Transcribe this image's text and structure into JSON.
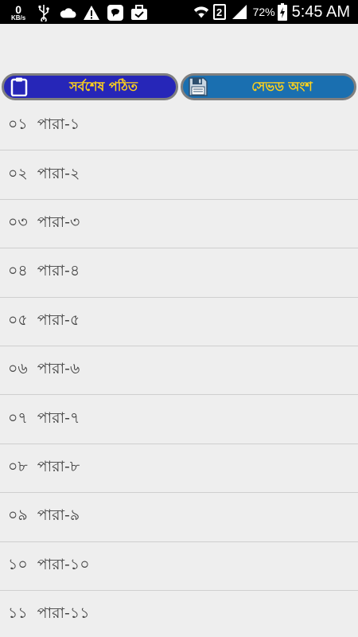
{
  "status_bar": {
    "net_speed_value": "0",
    "net_speed_unit": "KB/s",
    "sim_slot": "2",
    "battery_percent": "72%",
    "time": "5:45 AM",
    "icons": [
      "usb-icon",
      "cloud-icon",
      "warning-icon",
      "chat-icon",
      "briefcase-icon",
      "wifi-icon",
      "signal-icon",
      "battery-charging-icon"
    ]
  },
  "toolbar": {
    "recent_label": "সর্বশেষ পঠিত",
    "recent_icon": "clipboard-icon",
    "saved_label": "সেভড অংশ",
    "saved_icon": "save-icon"
  },
  "colors": {
    "recent_button_bg": "#2626b8",
    "saved_button_bg": "#1a6fb0",
    "label_color": "#ffd21a",
    "background": "#eeeeee"
  },
  "items": [
    {
      "num": "০১",
      "name": "পারা-১"
    },
    {
      "num": "০২",
      "name": "পারা-২"
    },
    {
      "num": "০৩",
      "name": "পারা-৩"
    },
    {
      "num": "০৪",
      "name": "পারা-৪"
    },
    {
      "num": "০৫",
      "name": "পারা-৫"
    },
    {
      "num": "০৬",
      "name": "পারা-৬"
    },
    {
      "num": "০৭",
      "name": "পারা-৭"
    },
    {
      "num": "০৮",
      "name": "পারা-৮"
    },
    {
      "num": "০৯",
      "name": "পারা-৯"
    },
    {
      "num": "১০",
      "name": "পারা-১০"
    },
    {
      "num": "১১",
      "name": "পারা-১১"
    }
  ]
}
